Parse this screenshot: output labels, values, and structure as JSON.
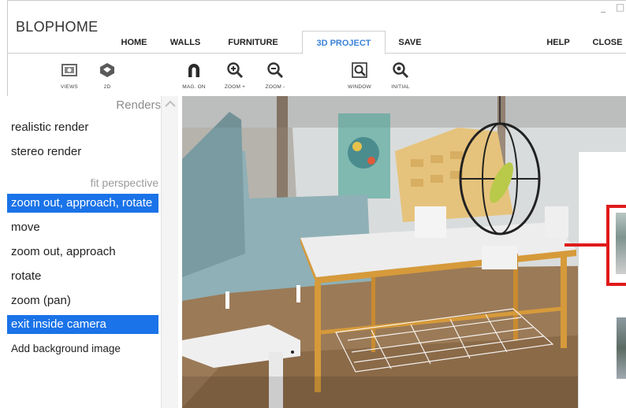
{
  "app": {
    "title": "BLOPHOME",
    "minimize": "_",
    "maximize": "□"
  },
  "tabs": [
    {
      "label": "HOME"
    },
    {
      "label": "WALLS"
    },
    {
      "label": "FURNITURE"
    },
    {
      "label": "3D PROJECT"
    },
    {
      "label": "SAVE"
    },
    {
      "label": "HELP"
    },
    {
      "label": "CLOSE"
    }
  ],
  "active_tab": "3D PROJECT",
  "toolbar": [
    {
      "label": "VIEWS",
      "icon": "views-icon"
    },
    {
      "label": "2D",
      "icon": "2d-icon"
    },
    {
      "label": "MAG. ON",
      "icon": "magnet-icon"
    },
    {
      "label": "ZOOM +",
      "icon": "zoom-in-icon"
    },
    {
      "label": "ZOOM -",
      "icon": "zoom-out-icon"
    },
    {
      "label": "WINDOW",
      "icon": "zoom-window-icon"
    },
    {
      "label": "INITIAL",
      "icon": "zoom-initial-icon"
    }
  ],
  "left_panel": {
    "heading": "Renders",
    "items": [
      {
        "label": "realistic render",
        "selected": false
      },
      {
        "label": "stereo render",
        "selected": false
      },
      {
        "label": "fit perspective",
        "kind": "subheading"
      },
      {
        "label": "zoom out, approach, rotate",
        "selected": true
      },
      {
        "label": "move",
        "selected": false
      },
      {
        "label": "zoom out, approach",
        "selected": false
      },
      {
        "label": "rotate",
        "selected": false
      },
      {
        "label": "zoom (pan)",
        "selected": false
      },
      {
        "label": "exit inside camera",
        "selected": true
      },
      {
        "label": "Add background image",
        "selected": false
      }
    ]
  },
  "colors": {
    "accent": "#3b82d6",
    "selection": "#1a73e8",
    "highlight": "#e01a1a"
  }
}
